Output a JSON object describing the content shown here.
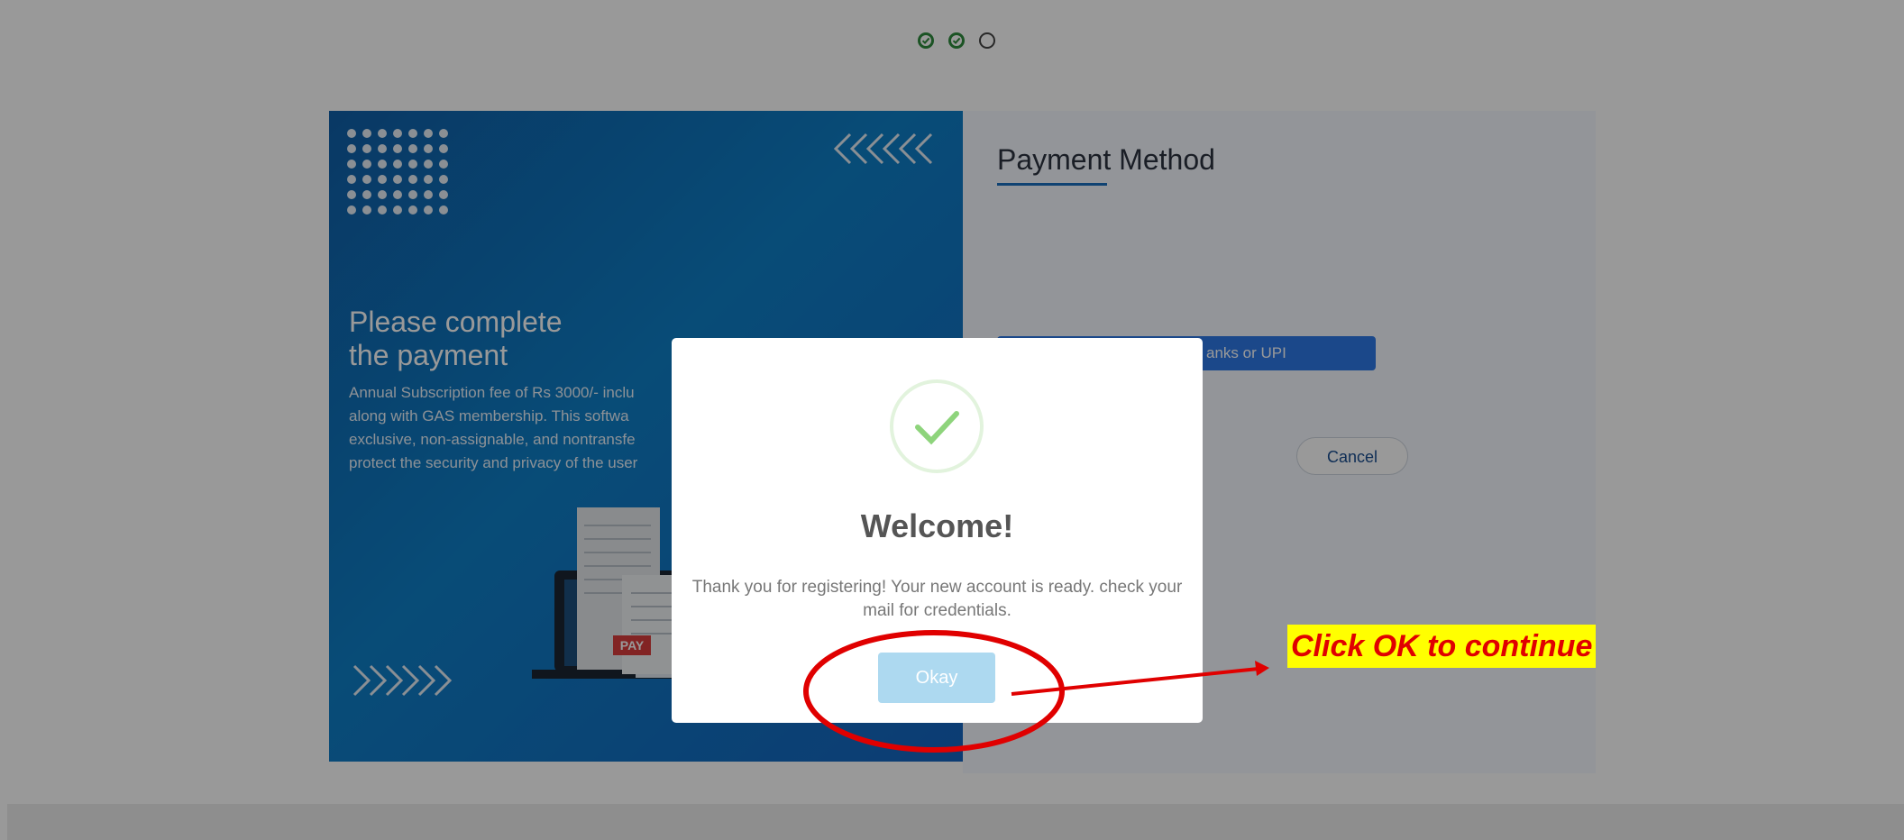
{
  "stepper": {
    "steps": [
      {
        "state": "done",
        "icon": "check-circle-icon"
      },
      {
        "state": "done",
        "icon": "check-circle-icon"
      },
      {
        "state": "current",
        "icon": "circle-icon"
      }
    ]
  },
  "promo": {
    "heading": "Please complete\nthe payment",
    "body": "Annual Subscription fee of Rs 3000/- inclu\nalong with GAS membership. This softwa\nexclusive, non-assignable, and nontransfe\nprotect the security and privacy of the user",
    "pay_tag": "PAY"
  },
  "payment": {
    "title": "Payment Method",
    "pay_option_label": "anks or UPI",
    "cancel_label": "Cancel"
  },
  "modal": {
    "title": "Welcome!",
    "message": "Thank you for registering! Your new account is ready. check your mail for credentials.",
    "ok_label": "Okay"
  },
  "annotation": {
    "text": "Click OK to continue",
    "text_color": "#e00000",
    "highlight_color": "#ffff00"
  },
  "colors": {
    "accent_blue": "#1a6fbf",
    "success_green": "#7fcf6e",
    "ok_button": "#add9f0"
  }
}
